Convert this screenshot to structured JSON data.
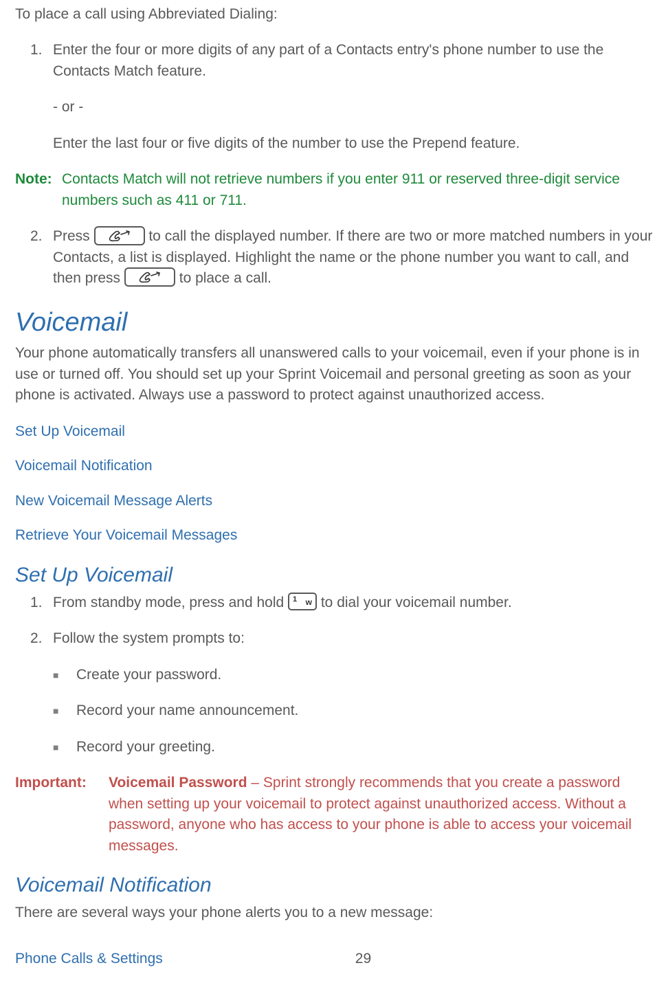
{
  "intro": "To place a call using Abbreviated Dialing:",
  "steps_a": {
    "n1": "1.",
    "t1": "Enter the four or more digits of any part of a Contacts entry's phone number to use the Contacts Match feature.",
    "or": "- or -",
    "t1b": "Enter the last four or five digits of the number to use the Prepend feature."
  },
  "note": {
    "label": "Note:",
    "text": "Contacts Match will not retrieve numbers if you enter 911 or reserved three-digit service numbers such as 411 or 711."
  },
  "steps_b": {
    "n2": "2.",
    "t2a": "Press ",
    "t2b": " to call the displayed number. If there are two or more matched numbers in your Contacts, a list is displayed. Highlight the name or the phone number you want to call, and then press ",
    "t2c": " to place a call."
  },
  "voicemail": {
    "heading": "Voicemail",
    "desc": "Your phone automatically transfers all unanswered calls to your voicemail, even if your phone is in use or turned off. You should set up your Sprint Voicemail and personal greeting as soon as your phone is activated. Always use a password to protect against unauthorized access."
  },
  "links": {
    "l1": "Set Up Voicemail",
    "l2": "Voicemail Notification",
    "l3": "New Voicemail Message Alerts",
    "l4": "Retrieve Your Voicemail Messages"
  },
  "setup": {
    "heading": "Set Up Voicemail",
    "n1": "1.",
    "t1a": "From standby mode, press and hold ",
    "t1b": " to dial your voicemail number.",
    "n2": "2.",
    "t2": "Follow the system prompts to:",
    "b1": "Create your password.",
    "b2": "Record your name announcement.",
    "b3": "Record your greeting."
  },
  "important": {
    "label": "Important:",
    "strong": "Voicemail Password",
    "text": " – Sprint strongly recommends that you create a password when setting up your voicemail to protect against unauthorized access. Without a password, anyone who has access to your phone is able to access your voicemail messages."
  },
  "notification": {
    "heading": "Voicemail Notification",
    "desc": "There are several ways your phone alerts you to a new message:"
  },
  "footer": {
    "section": "Phone Calls & Settings",
    "page": "29"
  },
  "key1_label": "1",
  "key1_sub": "w"
}
